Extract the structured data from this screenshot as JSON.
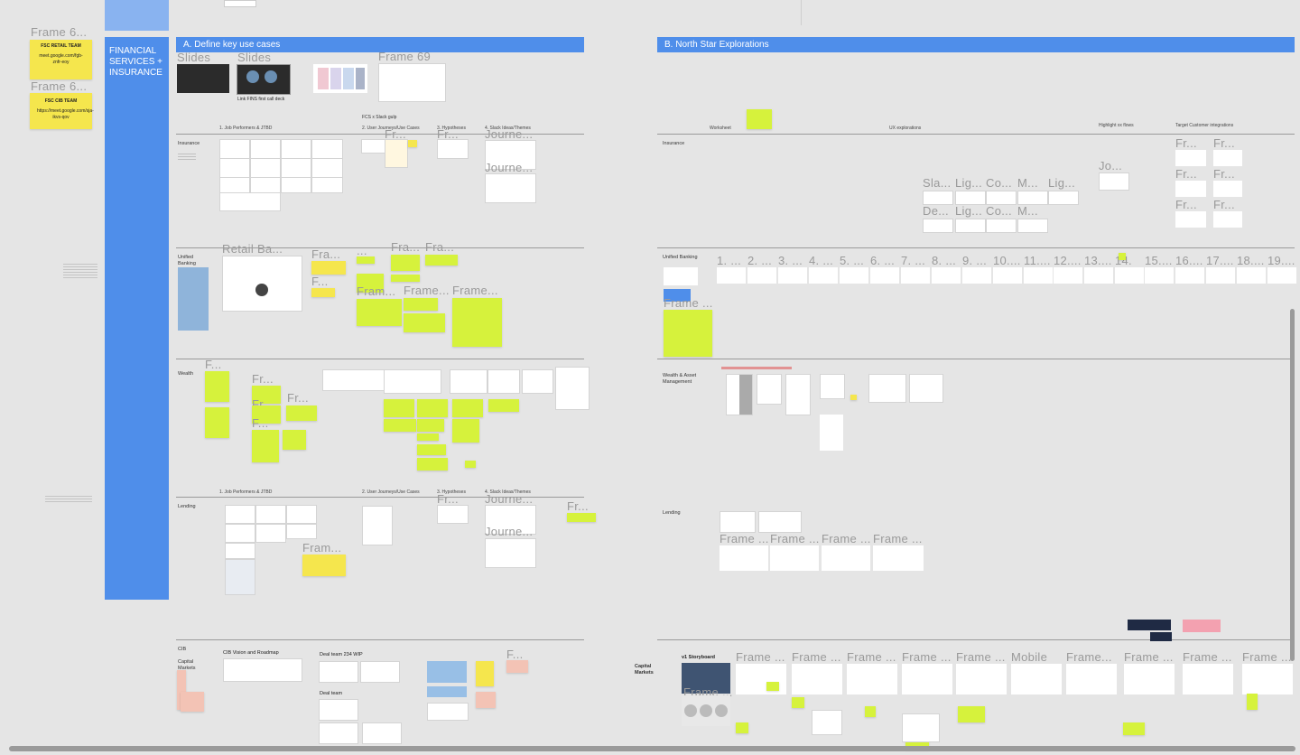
{
  "sidebar": {
    "frame_label_1": "Frame 6...",
    "frame_label_2": "Frame 6...",
    "sticky_1_title": "FSC RETAIL TEAM",
    "sticky_1_link": "meet.google.com/fgb-znfr-eoy",
    "sticky_2_title": "FSC CIB TEAM",
    "sticky_2_link": "https://meet.google.com/sja-ikvs-qov",
    "vertical_title": "FINANCIAL SERVICES + INSURANCE"
  },
  "section_a": {
    "banner": "A. Define key use cases",
    "slides_label_1": "Slides",
    "slides_label_2": "Slides",
    "slide_caption": "Link FINS first call deck",
    "frame69_label": "Frame 69",
    "fcs_slack": "FCS x Slack gulp",
    "cols": [
      "1. Job Performers & JTBD",
      "2. User Journeys/Use Cases",
      "3. Hypotheses",
      "4. Slack Ideas/Themes"
    ],
    "rows": {
      "insurance": "Insurance",
      "unified_banking": "Unified\nBanking",
      "wealth": "Wealth",
      "lending": "Lending",
      "cib": "CIB",
      "capital_markets": "Capital\nMarkets"
    },
    "frame_labels": {
      "fr_ins_uj": "Fr...",
      "fr_ins_hyp": "Fr...",
      "journey_1": "Journe...",
      "journey_2": "Journe...",
      "retail_ba": "Retail Ba...",
      "fra_ub_1": "Fra...",
      "fra_ub_2": "Fra...",
      "fra_ub_3": "Fra...",
      "f_ub_1": "F...",
      "fram_ub": "Fram...",
      "frame_ub_1": "Frame...",
      "frame_ub_2": "Frame...",
      "dots": "...",
      "f_wealth": "F...",
      "fr_w1": "Fr...",
      "fr_w2": "Fr...",
      "fr_w3": "Fr...",
      "f_w4": "F...",
      "fram_lending": "Fram...",
      "fr_lending_right": "Fr...",
      "journey_3": "Journe...",
      "journey_4": "Journe...",
      "fr_lend_hyp": "Fr..."
    },
    "cib": {
      "vision": "CIB Vision and Roadmap",
      "deal_team_wip": "Deal team 234 WIP",
      "deal_team": "Deal team",
      "f_label": "F..."
    }
  },
  "section_b": {
    "banner": "B.  North Star Explorations",
    "cols": [
      "Worksheet",
      "UX explorations",
      "Highlight xx flows",
      "Target Customer integrations"
    ],
    "rows": {
      "insurance": "Insurance",
      "unified_banking": "Unified Banking",
      "wealth": "Wealth & Asset\nManagement",
      "lending": "Lending",
      "capital_markets": "Capital\nMarkets"
    },
    "ins_labels_row1": [
      "Sla...",
      "Lig...",
      "Co...",
      "M...",
      "Lig..."
    ],
    "ins_labels_row2": [
      "De...",
      "Lig...",
      "Co...",
      "M..."
    ],
    "jo_label": "Jo...",
    "target_frames": [
      "Fr...",
      "Fr...",
      "Fr...",
      "Fr...",
      "Fr...",
      "Fr..."
    ],
    "ub_numbers": [
      "1. ...",
      "2. ...",
      "3. ...",
      "4. ...",
      "5. ...",
      "6. ...",
      "7. ...",
      "8. ...",
      "9. ...",
      "10....",
      "11....",
      "12....",
      "13....",
      "14.",
      "15....",
      "16....",
      "17....",
      "18....",
      "19...."
    ],
    "ub_frame": "Frame ...",
    "lending_frames": [
      "Frame ...",
      "Frame ...",
      "Frame ...",
      "Frame ..."
    ],
    "storyboard": "v1 Storyboard",
    "cm_frames": [
      "Frame ...",
      "Frame ...",
      "Frame ...",
      "Frame ...",
      "Frame ...",
      "Mobile",
      "Frame...",
      "Frame ...",
      "Frame ...",
      "Frame ..."
    ],
    "frame_small": "Frame ..."
  },
  "colors": {
    "canvas": "#e5e5e5",
    "banner_blue": "#4f8eea",
    "sticky_yellow": "#f5e64d",
    "sticky_green": "#d6f23c",
    "frame_label": "#9a9a9a"
  }
}
